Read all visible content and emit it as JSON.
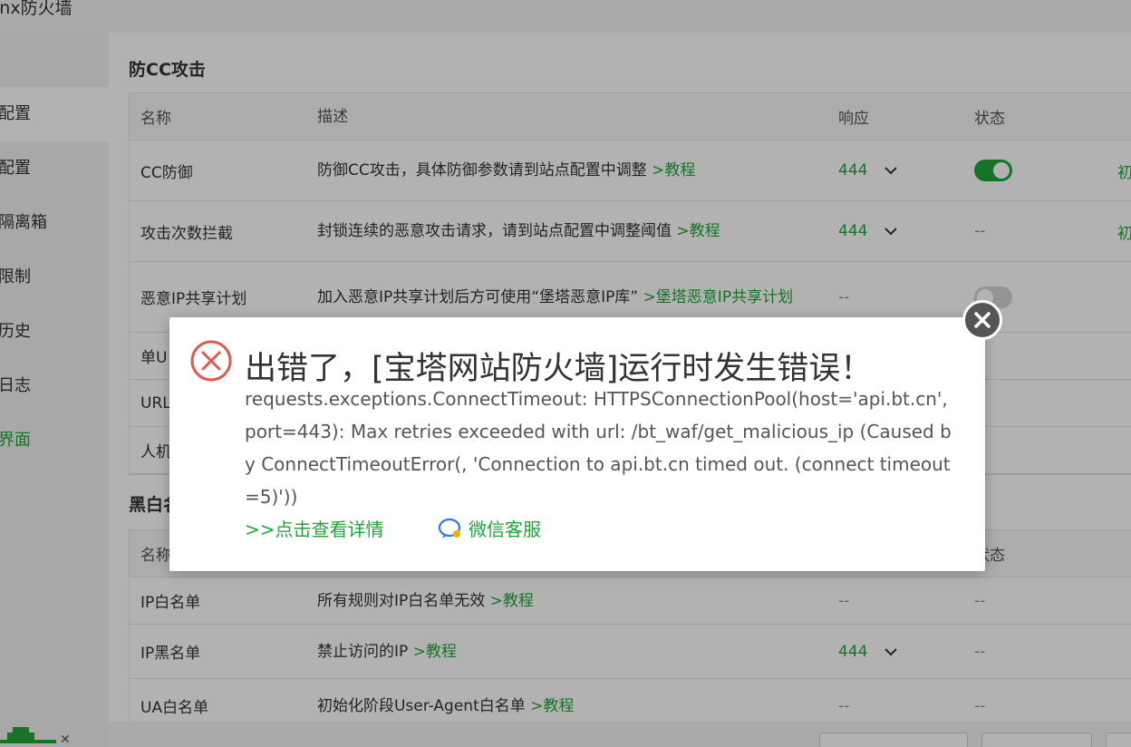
{
  "app": {
    "title": "inx防火墙"
  },
  "sidebar": {
    "items": [
      {
        "label": "配置",
        "active": true
      },
      {
        "label": "配置",
        "active": false
      },
      {
        "label": "隔离箱",
        "active": false
      },
      {
        "label": "限制",
        "active": false
      },
      {
        "label": "历史",
        "active": false
      },
      {
        "label": "日志",
        "active": false
      },
      {
        "label": "界面",
        "active": false,
        "green": true
      }
    ]
  },
  "cc_section": {
    "title": "防CC攻击",
    "headers": {
      "name": "名称",
      "desc": "描述",
      "resp": "响应",
      "status": "状态"
    },
    "rows": [
      {
        "name": "CC防御",
        "desc": "防御CC攻击，具体防御参数请到站点配置中调整",
        "link": ">教程",
        "resp": "444",
        "status": "on",
        "op": "初"
      },
      {
        "name": "攻击次数拦截",
        "desc": "封锁连续的恶意攻击请求，请到站点配置中调整阈值",
        "link": ">教程",
        "resp": "444",
        "status": "--",
        "op": "初"
      },
      {
        "name": "恶意IP共享计划",
        "desc": "加入恶意IP共享计划后方可使用“堡塔恶意IP库”",
        "link": ">堡塔恶意IP共享计划",
        "resp": "--",
        "status": "off"
      },
      {
        "name": "单U"
      },
      {
        "name": "URL"
      },
      {
        "name": "人机"
      }
    ]
  },
  "bw_section": {
    "title": "黑白名单",
    "headers": {
      "name": "名称",
      "status": "状态"
    },
    "rows": [
      {
        "name": "IP白名单",
        "desc": "所有规则对IP白名单无效",
        "link": ">教程",
        "resp": "--",
        "status": "--"
      },
      {
        "name": "IP黑名单",
        "desc": "禁止访问的IP",
        "link": ">教程",
        "resp": "444",
        "status": "--"
      },
      {
        "name": "UA白名单",
        "desc": "初始化阶段User-Agent白名单",
        "link": ">教程",
        "resp": "--",
        "status": "--"
      }
    ]
  },
  "dialog": {
    "title": "出错了，[宝塔网站防火墙]运行时发生错误！",
    "message": "requests.exceptions.ConnectTimeout: HTTPSConnectionPool(host='api.bt.cn', port=443): Max retries exceeded with url: /bt_waf/get_malicious_ip (Caused by ConnectTimeoutError(, 'Connection to api.bt.cn timed out. (connect timeout=5)'))",
    "details_link": ">>点击查看详情",
    "wechat_link": "微信客服",
    "icon": "error-circle-icon"
  },
  "colors": {
    "accent": "#20a53a",
    "error": "#e05a4e",
    "close_bg": "#555555"
  }
}
